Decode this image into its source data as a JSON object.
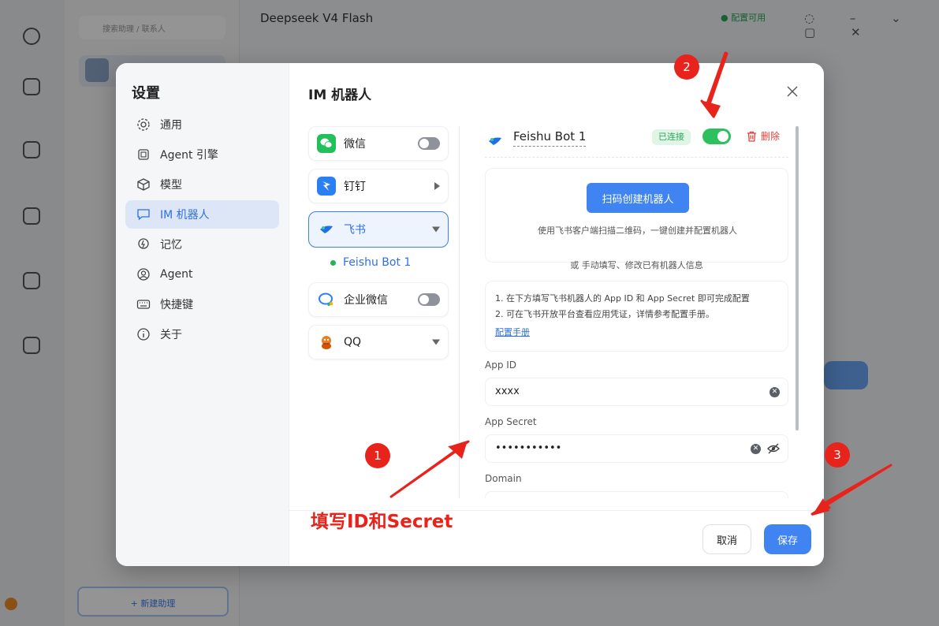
{
  "background": {
    "title": "Deepseek V4 Flash",
    "search_placeholder": "搜索助理 / 联系人",
    "status": "● 配置可用",
    "new_button": "+ 新建助理"
  },
  "settings": {
    "title": "设置",
    "nav": [
      {
        "label": "通用",
        "icon": "gear-icon"
      },
      {
        "label": "Agent 引擎",
        "icon": "chip-icon"
      },
      {
        "label": "模型",
        "icon": "cube-icon"
      },
      {
        "label": "IM 机器人",
        "icon": "chat-bubble-icon"
      },
      {
        "label": "记忆",
        "icon": "bulb-icon"
      },
      {
        "label": "Agent",
        "icon": "user-circle-icon"
      },
      {
        "label": "快捷键",
        "icon": "keyboard-icon"
      },
      {
        "label": "关于",
        "icon": "info-icon"
      }
    ]
  },
  "im": {
    "title": "IM 机器人",
    "platforms": [
      {
        "label": "微信",
        "state": "off"
      },
      {
        "label": "钉钉",
        "state": "collapsed"
      },
      {
        "label": "飞书",
        "state": "expanded"
      },
      {
        "label": "企业微信",
        "state": "off"
      },
      {
        "label": "QQ",
        "state": "expanded"
      }
    ],
    "bot_item": "Feishu Bot 1"
  },
  "bot": {
    "name": "Feishu Bot 1",
    "badge": "已连接",
    "delete_label": "删除",
    "qr_button": "扫码创建机器人",
    "qr_tip": "使用飞书客户端扫描二维码，一键创建并配置机器人",
    "or_text": "或 手动填写、修改已有机器人信息",
    "info_lines": [
      "1. 在下方填写飞书机器人的 App ID 和 App Secret 即可完成配置",
      "2. 可在飞书开放平台查看应用凭证，详情参考配置手册。"
    ],
    "manual_link": "配置手册",
    "app_id_label": "App ID",
    "app_id_value": "xxxx",
    "secret_label": "App Secret",
    "secret_value": "•••••••••••",
    "domain_label": "Domain"
  },
  "footer": {
    "cancel": "取消",
    "save": "保存"
  },
  "annotations": {
    "n1": "1",
    "n2": "2",
    "n3": "3",
    "text": "填写ID和Secret",
    "color": "#e8231c"
  },
  "colors": {
    "accent": "#3f84f0",
    "success": "#2ec05e",
    "danger": "#e0413a"
  }
}
